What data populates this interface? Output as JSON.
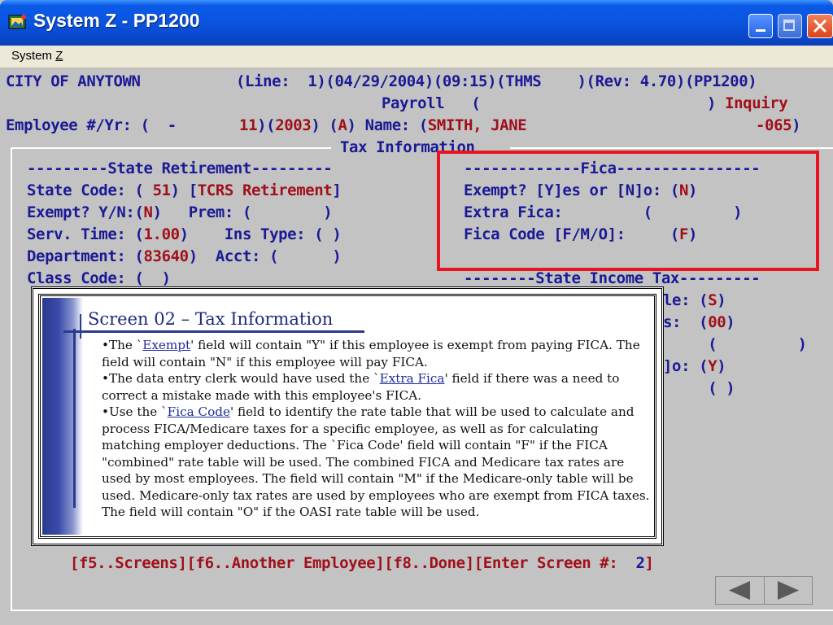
{
  "window": {
    "title": "System Z - PP1200"
  },
  "menu": {
    "system_prefix": "System ",
    "system_key": "Z"
  },
  "header": {
    "line1": {
      "org": "CITY OF ANYTOWN",
      "line_label": "(Line:",
      "line_no": "1",
      "date": "04/29/2004",
      "time": "09:15",
      "user": "THMS",
      "rev_label": "(Rev:",
      "rev": "4.70",
      "program": "PP1200"
    },
    "line2": {
      "left": "Payroll",
      "right": "Inquiry"
    },
    "line3": {
      "label": "Employee #/Yr: (",
      "dash": "-",
      "emp_no": "11",
      "year": "2003",
      "status": "A",
      "name_label": "Name:",
      "name": "SMITH, JANE",
      "suffix": "-065"
    }
  },
  "panel": {
    "title": "Tax Information"
  },
  "retirement": {
    "heading": "---------State Retirement---------",
    "state_code_label": "State Code:",
    "state_code": "51",
    "state_code_desc": "TCRS Retirement",
    "exempt_label": "Exempt? Y/N:",
    "exempt": "N",
    "prem_label": "Prem:",
    "serv_time_label": "Serv. Time:",
    "serv_time": "1.00",
    "ins_type_label": "Ins Type:",
    "department_label": "Department:",
    "department": "83640",
    "acct_label": "Acct:",
    "class_code_label": "Class Code:"
  },
  "fica": {
    "heading": "-------------Fica----------------",
    "exempt_label": "Exempt? [Y]es or [N]o:",
    "exempt": "N",
    "extra_label": "Extra Fica:",
    "code_label": "Fica Code [F/M/O]:",
    "code": "F"
  },
  "state_income_tax": {
    "heading": "--------State Income Tax---------",
    "row1_label_tail": "le:",
    "row1_value": "S",
    "row2_label_tail": "s:",
    "row2_value": "00",
    "row4_label_tail": "]o:",
    "row4_value": "Y"
  },
  "callout": {
    "title": "Screen 02 – Tax Information",
    "p1_pre": "•The `",
    "p1_link": "Exempt",
    "p1_post": "' field will contain \"Y\" if this employee is exempt from paying FICA. The field will contain \"N\" if this employee will pay FICA.",
    "p2_pre": "•The data entry clerk would have used the `",
    "p2_link": "Extra Fica",
    "p2_post": "' field if there was a need to correct a mistake made with this employee's FICA.",
    "p3_pre": "•Use the `",
    "p3_link": "Fica Code",
    "p3_post": "' field to identify the rate table that will be used to calculate and process FICA/Medicare taxes for a specific employee, as well as for calculating matching employer deductions. The `Fica Code' field will contain \"F\" if the FICA \"combined\" rate table will be used. The combined FICA and Medicare tax rates are used by most employees. The field will contain \"M\" if the Medicare-only table will be used. Medicare-only tax rates are used by employees who are exempt from FICA taxes. The field will contain \"O\" if the OASI rate table will be used."
  },
  "footer": {
    "f5": "[f5..Screens]",
    "f6": "[f6..Another Employee]",
    "f8": "[f8..Done]",
    "enter_label": "[Enter Screen #:",
    "screen_no": "2",
    "close": "]"
  },
  "icons": {
    "window": "app-icon",
    "prev": "prev-arrow-icon",
    "next": "next-arrow-icon"
  },
  "colors": {
    "title_bar": "#0a54e0",
    "terminal_bg": "#c3c3c3",
    "terminal_text": "#1a1a96",
    "value_text": "#a0101a",
    "highlight": "#e8141e"
  }
}
